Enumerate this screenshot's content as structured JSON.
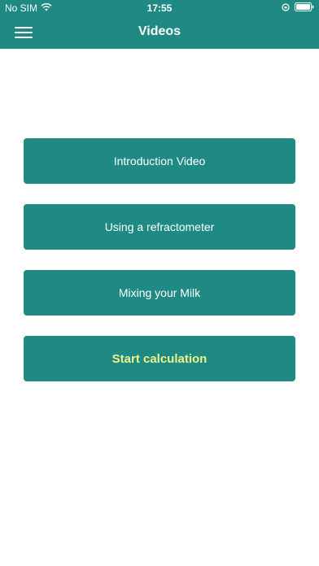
{
  "status_bar": {
    "carrier": "No SIM",
    "time": "17:55"
  },
  "header": {
    "title": "Videos"
  },
  "buttons": [
    {
      "label": "Introduction Video"
    },
    {
      "label": "Using a refractometer"
    },
    {
      "label": "Mixing your Milk"
    },
    {
      "label": "Start calculation"
    }
  ],
  "colors": {
    "accent": "#1f8a84",
    "highlight_text": "#f0f08c"
  },
  "icons": {
    "wifi": "wifi-icon",
    "orientation_lock": "orientation-lock-icon",
    "battery": "battery-icon",
    "menu": "hamburger-menu-icon"
  }
}
